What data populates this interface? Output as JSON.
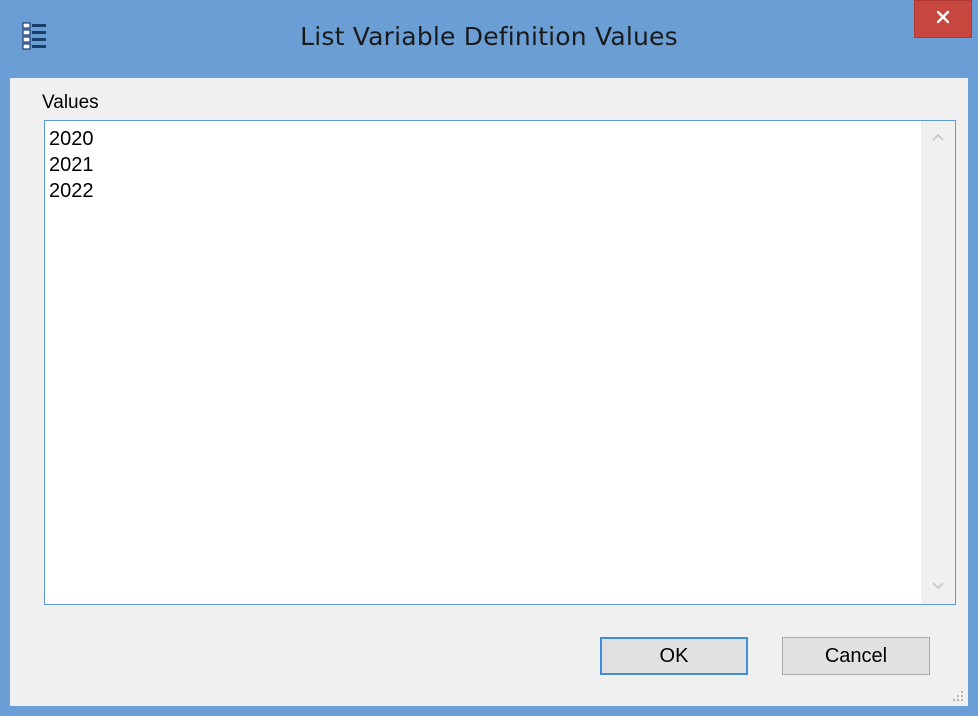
{
  "window": {
    "title": "List Variable Definition Values",
    "icon": "list-icon",
    "close_icon": "close-icon",
    "accent_color": "#6b9ed5",
    "close_color": "#c7463e"
  },
  "form": {
    "values_label": "Values",
    "values": [
      "2020",
      "2021",
      "2022"
    ]
  },
  "buttons": {
    "ok_label": "OK",
    "cancel_label": "Cancel"
  }
}
